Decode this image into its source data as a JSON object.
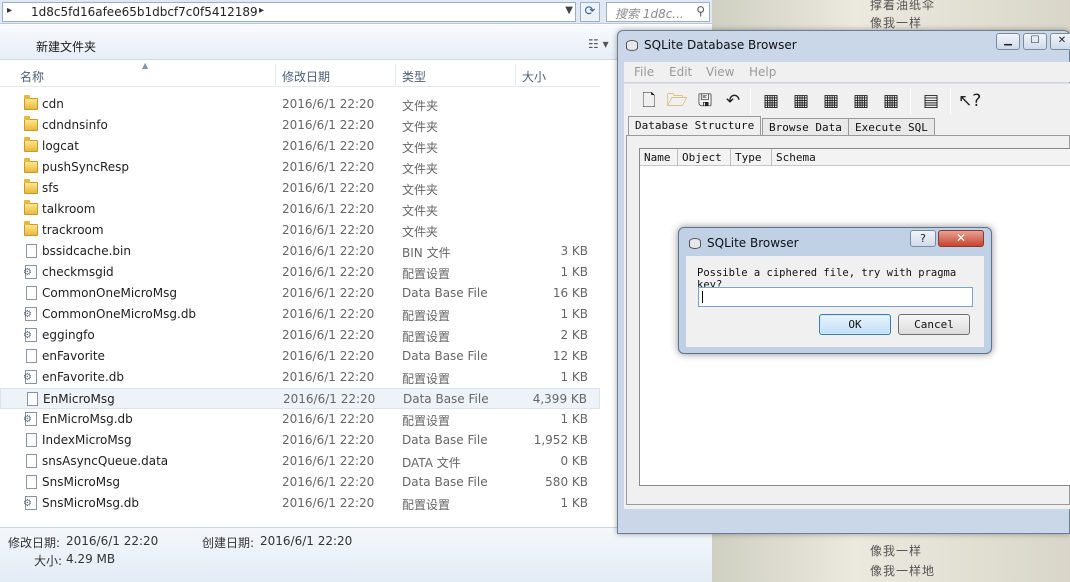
{
  "explorer": {
    "address": "1d8c5fd16afee65b1dbcf7c0f5412189",
    "search_placeholder": "搜索 1d8c...",
    "toolbar": {
      "new_folder": "新建文件夹"
    },
    "columns": {
      "name": "名称",
      "date": "修改日期",
      "type": "类型",
      "size": "大小"
    },
    "files": [
      {
        "name": "cdn",
        "date": "2016/6/1 22:20",
        "type": "文件夹",
        "size": "",
        "icon": "folder"
      },
      {
        "name": "cdndnsinfo",
        "date": "2016/6/1 22:20",
        "type": "文件夹",
        "size": "",
        "icon": "folder"
      },
      {
        "name": "logcat",
        "date": "2016/6/1 22:20",
        "type": "文件夹",
        "size": "",
        "icon": "folder"
      },
      {
        "name": "pushSyncResp",
        "date": "2016/6/1 22:20",
        "type": "文件夹",
        "size": "",
        "icon": "folder"
      },
      {
        "name": "sfs",
        "date": "2016/6/1 22:20",
        "type": "文件夹",
        "size": "",
        "icon": "folder"
      },
      {
        "name": "talkroom",
        "date": "2016/6/1 22:20",
        "type": "文件夹",
        "size": "",
        "icon": "folder"
      },
      {
        "name": "trackroom",
        "date": "2016/6/1 22:20",
        "type": "文件夹",
        "size": "",
        "icon": "folder"
      },
      {
        "name": "bssidcache.bin",
        "date": "2016/6/1 22:20",
        "type": "BIN 文件",
        "size": "3 KB",
        "icon": "file"
      },
      {
        "name": "checkmsgid",
        "date": "2016/6/1 22:20",
        "type": "配置设置",
        "size": "1 KB",
        "icon": "cfg"
      },
      {
        "name": "CommonOneMicroMsg",
        "date": "2016/6/1 22:20",
        "type": "Data Base File",
        "size": "16 KB",
        "icon": "file"
      },
      {
        "name": "CommonOneMicroMsg.db",
        "date": "2016/6/1 22:20",
        "type": "配置设置",
        "size": "1 KB",
        "icon": "cfg"
      },
      {
        "name": "eggingfo",
        "date": "2016/6/1 22:20",
        "type": "配置设置",
        "size": "2 KB",
        "icon": "cfg"
      },
      {
        "name": "enFavorite",
        "date": "2016/6/1 22:20",
        "type": "Data Base File",
        "size": "12 KB",
        "icon": "file"
      },
      {
        "name": "enFavorite.db",
        "date": "2016/6/1 22:20",
        "type": "配置设置",
        "size": "1 KB",
        "icon": "cfg"
      },
      {
        "name": "EnMicroMsg",
        "date": "2016/6/1 22:20",
        "type": "Data Base File",
        "size": "4,399 KB",
        "icon": "file",
        "selected": true
      },
      {
        "name": "EnMicroMsg.db",
        "date": "2016/6/1 22:20",
        "type": "配置设置",
        "size": "1 KB",
        "icon": "cfg"
      },
      {
        "name": "IndexMicroMsg",
        "date": "2016/6/1 22:20",
        "type": "Data Base File",
        "size": "1,952 KB",
        "icon": "file"
      },
      {
        "name": "snsAsyncQueue.data",
        "date": "2016/6/1 22:20",
        "type": "DATA 文件",
        "size": "0 KB",
        "icon": "file"
      },
      {
        "name": "SnsMicroMsg",
        "date": "2016/6/1 22:20",
        "type": "Data Base File",
        "size": "580 KB",
        "icon": "file"
      },
      {
        "name": "SnsMicroMsg.db",
        "date": "2016/6/1 22:20",
        "type": "配置设置",
        "size": "1 KB",
        "icon": "cfg"
      }
    ],
    "status": {
      "modified_label": "修改日期:",
      "modified_value": "2016/6/1 22:20",
      "created_label": "创建日期:",
      "created_value": "2016/6/1 22:20",
      "size_label": "大小:",
      "size_value": "4.29 MB"
    }
  },
  "wallpaper": {
    "lines": [
      "撑着油纸伞",
      "像我一样",
      "像我一样",
      "像我一样地"
    ]
  },
  "sqlite": {
    "title": "SQLite Database Browser",
    "menu": [
      "File",
      "Edit",
      "View",
      "Help"
    ],
    "tabs": [
      "Database Structure",
      "Browse Data",
      "Execute SQL"
    ],
    "tree_columns": [
      "Name",
      "Object",
      "Type",
      "Schema"
    ]
  },
  "dialog": {
    "title": "SQLite Browser",
    "help": "?",
    "message": "Possible a ciphered file, try with pragma key?",
    "input_value": "",
    "ok": "OK",
    "cancel": "Cancel"
  },
  "colors": {
    "selection": "#eef3fa",
    "close_red": "#c7432f",
    "accent": "#3c7fb1"
  }
}
